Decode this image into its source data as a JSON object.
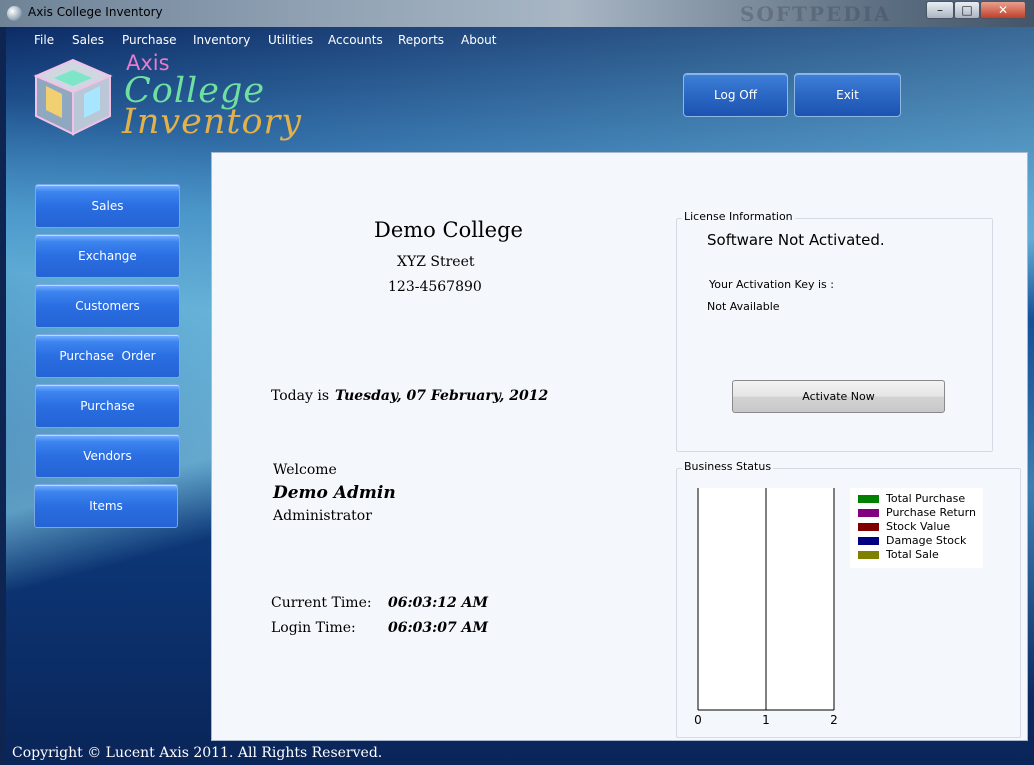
{
  "window": {
    "title": "Axis College Inventory",
    "watermark": "SOFTPEDIA"
  },
  "menu": [
    "File",
    "Sales",
    "Purchase",
    "Inventory",
    "Utilities",
    "Accounts",
    "Reports",
    "About"
  ],
  "logo": {
    "line1": "Axis",
    "line2": "College",
    "line3": "Inventory"
  },
  "top_buttons": {
    "logoff": "Log Off",
    "exit": "Exit"
  },
  "sidebar": {
    "items": [
      {
        "label": "Sales"
      },
      {
        "label": "Exchange"
      },
      {
        "label": "Customers"
      },
      {
        "label": "Purchase  Order"
      },
      {
        "label": "Purchase"
      },
      {
        "label": "Vendors"
      },
      {
        "label": "Items"
      }
    ]
  },
  "college": {
    "name": "Demo College",
    "street": "XYZ Street",
    "phone": "123-4567890"
  },
  "today": {
    "label": "Today is",
    "value": "Tuesday, 07 February, 2012"
  },
  "user": {
    "welcome": "Welcome",
    "name": "Demo Admin",
    "role": "Administrator"
  },
  "times": {
    "current_label": "Current Time:",
    "current_value": "06:03:12 AM",
    "login_label": "Login Time:",
    "login_value": "06:03:07 AM"
  },
  "license": {
    "title": "License Information",
    "status": "Software Not Activated.",
    "key_label": "Your Activation Key is :",
    "key_value": "Not Available",
    "activate_button": "Activate Now"
  },
  "business": {
    "title": "Business Status"
  },
  "chart_data": {
    "type": "bar",
    "x_ticks": [
      "0",
      "1",
      "2"
    ],
    "xlim": [
      0,
      2
    ],
    "series": [
      {
        "name": "Total Purchase",
        "color": "#008000",
        "values": []
      },
      {
        "name": "Purchase Return",
        "color": "#800080",
        "values": []
      },
      {
        "name": "Stock Value",
        "color": "#800000",
        "values": []
      },
      {
        "name": "Damage Stock",
        "color": "#000080",
        "values": []
      },
      {
        "name": "Total Sale",
        "color": "#808000",
        "values": []
      }
    ],
    "legend_position": "top-right"
  },
  "footer": {
    "copyright": "Copyright © Lucent Axis 2011. All Rights Reserved."
  }
}
